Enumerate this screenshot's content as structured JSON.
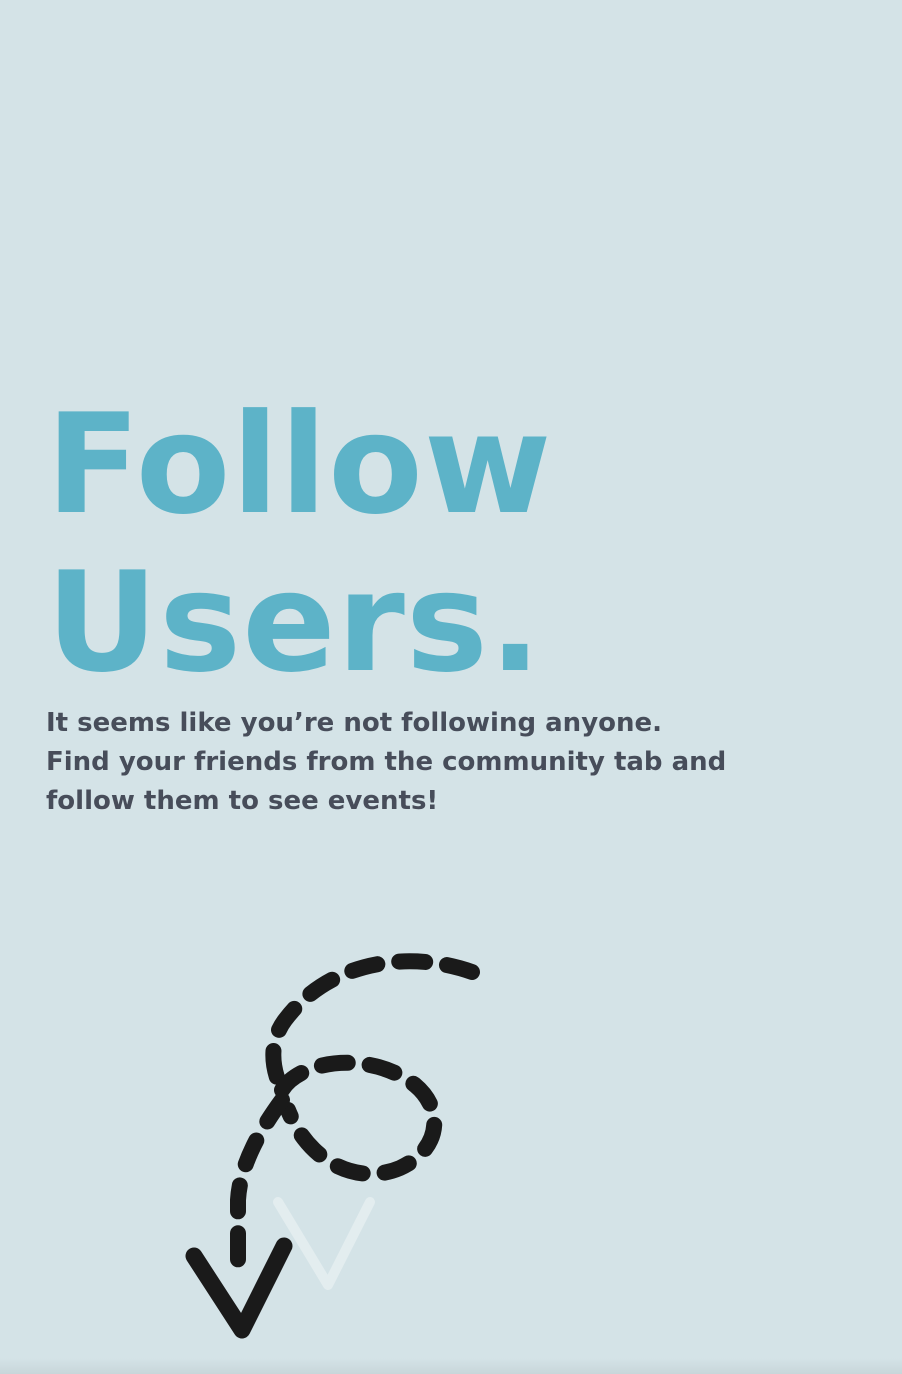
{
  "empty_state": {
    "title_line_1": "Follow",
    "title_line_2": "Users.",
    "message_line_1": "It seems like you’re not following anyone.",
    "message_line_2": "Find your friends from the community tab and",
    "message_line_3": "follow them to see events!"
  },
  "illustration": {
    "icon": "dashed-loop-arrow-down-icon",
    "stroke_color": "#1a1a1a"
  },
  "colors": {
    "background": "#d4e3e7",
    "title": "#5db3c8",
    "message": "#474d5a"
  }
}
